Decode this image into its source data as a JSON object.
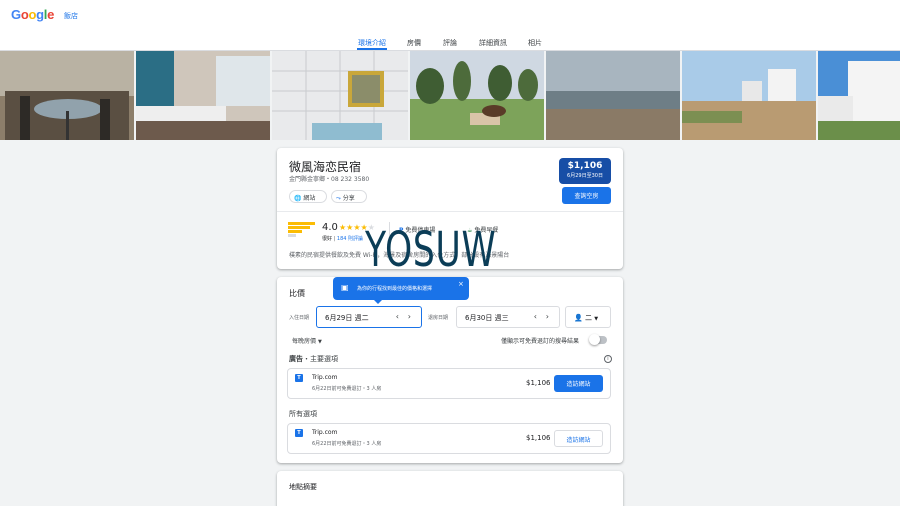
{
  "header": {
    "logo": "Google",
    "hotels_link": "飯店"
  },
  "tabs": [
    {
      "label": "環境介紹",
      "active": true
    },
    {
      "label": "房價",
      "active": false
    },
    {
      "label": "評論",
      "active": false
    },
    {
      "label": "詳細資訊",
      "active": false
    },
    {
      "label": "相片",
      "active": false
    }
  ],
  "hotel": {
    "name": "微風海恋民宿",
    "address": "金門縣金寧鄉・08 232 3580",
    "website_label": "網站",
    "share_label": "分享",
    "price": "$1,106",
    "price_dates": "6月29日至30日",
    "check_label": "查詢空房",
    "rating": "4.0",
    "rating_word": "很好",
    "review_count": "184 則評論",
    "amenity1": "免費停車場",
    "amenity2": "免費早餐",
    "description": "樸素的民宿提供餐飲及免費 Wi-Fi，海景及宿舍房間的入住方式，部分設有海景陽台"
  },
  "compare": {
    "title": "比價",
    "tooltip": "為你的行程找到最佳的價格和選擇",
    "checkin_label": "入住日期",
    "checkin_value": "6月29日 週二",
    "checkout_label": "退房日期",
    "checkout_value": "6月30日 週三",
    "guests_value": "二",
    "nightly_label": "每晚房價",
    "free_cancel_label": "僅顯示可免費退訂的搜尋結果",
    "ads_heading_ad": "廣告",
    "ads_heading": "・主要選項",
    "all_heading": "所有選項",
    "offers": [
      {
        "provider": "Trip.com",
        "note": "6月22日前可免費退訂・3 人房",
        "price": "$1,106",
        "button": "造訪網站"
      },
      {
        "provider": "Trip.com",
        "note": "6月22日前可免費退訂・3 人房",
        "price": "$1,106",
        "button": "造訪網站"
      }
    ]
  },
  "location": {
    "title": "地點摘要"
  },
  "watermark": "YOSUW",
  "colors": {
    "accent": "#1a73e8",
    "price_box": "#174ea6"
  }
}
